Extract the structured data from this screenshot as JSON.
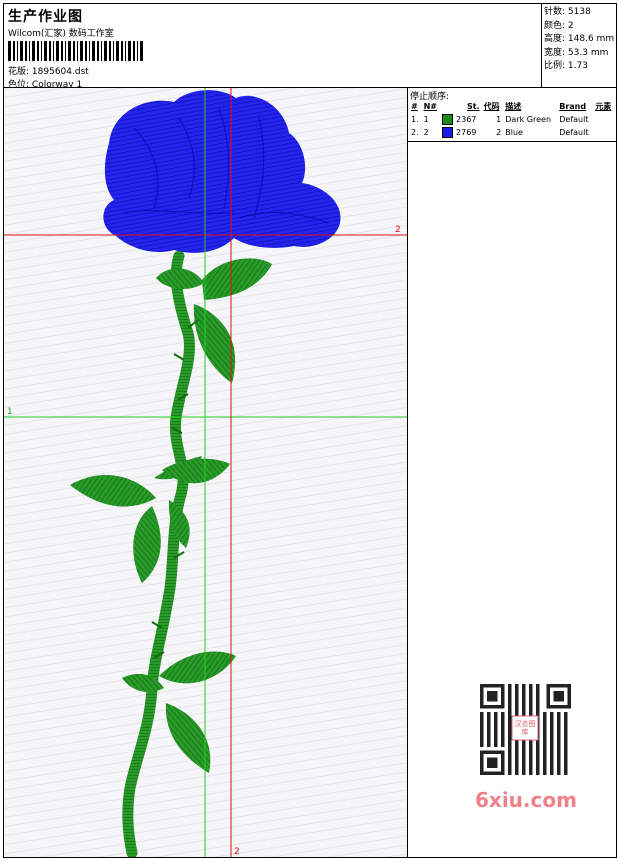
{
  "header": {
    "title": "生产作业图",
    "studio": "Wilcom(汇家) 数码工作室",
    "design_label": "花版:",
    "design_value": "1895604.dst",
    "colorway_label": "色位:",
    "colorway_value": "Colorway 1"
  },
  "stats": [
    {
      "label": "针数:",
      "value": "5138"
    },
    {
      "label": "颜色:",
      "value": "2"
    },
    {
      "label": "高度:",
      "value": "148.6 mm"
    },
    {
      "label": "宽度:",
      "value": "53.3 mm"
    },
    {
      "label": "比例:",
      "value": "1.73"
    }
  ],
  "stop_sequence": {
    "title": "停止顺序:",
    "columns": [
      "#",
      "N#",
      "St.",
      "代码",
      "描述",
      "Brand",
      "元素"
    ],
    "rows": [
      {
        "idx": "1.",
        "n": "1",
        "color": "#1a8a1a",
        "st": "2367",
        "code": "1",
        "desc": "Dark Green",
        "brand": "Default",
        "element": ""
      },
      {
        "idx": "2.",
        "n": "2",
        "color": "#1a1ae6",
        "st": "2769",
        "code": "2",
        "desc": "Blue",
        "brand": "Default",
        "element": ""
      }
    ]
  },
  "guides": {
    "horizontal_red_label": "2",
    "horizontal_green_label": "1",
    "vertical_red_label": "2"
  },
  "watermark": {
    "qr_caption": "汉衣图库",
    "site": "6xiu.com"
  },
  "colors": {
    "thread_green": "#1a8a1a",
    "thread_blue": "#1a1ae6",
    "guide_red": "#e01010",
    "guide_green": "#20d020"
  }
}
